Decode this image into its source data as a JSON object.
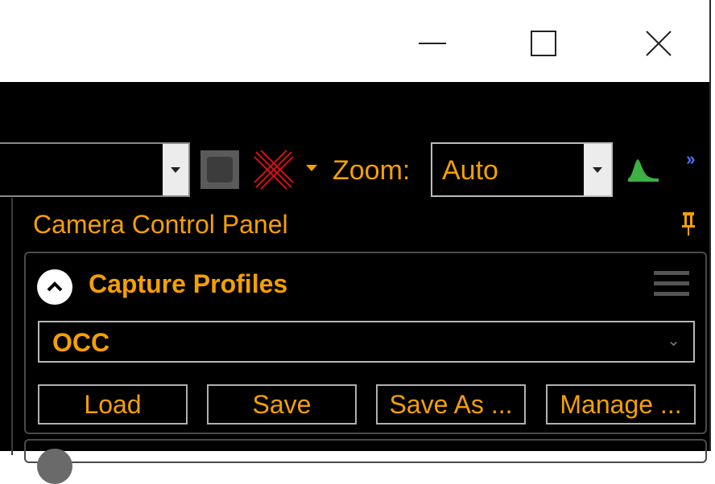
{
  "window": {
    "minimize_icon": "minimize-icon",
    "maximize_icon": "maximize-icon",
    "close_icon": "close-icon"
  },
  "toolbar": {
    "left_combo_value": "",
    "square_icon": "frame-icon",
    "crosshair_icon": "crosshair-x-icon",
    "zoom_label": "Zoom:",
    "zoom_value": "Auto",
    "histogram_icon": "histogram-icon",
    "overflow_icon": "chevron-double-right-icon"
  },
  "panel": {
    "title": "Camera Control Panel",
    "pin_icon": "pin-icon",
    "section": {
      "title": "Capture Profiles",
      "profile_value": "OCC",
      "buttons": [
        "Load",
        "Save",
        "Save As ...",
        "Manage ..."
      ]
    }
  },
  "colors": {
    "accent": "#f5a000",
    "background": "#000000",
    "border": "#b0b0b0",
    "histogram": "#3cb043",
    "crosshair": "#d01010"
  }
}
